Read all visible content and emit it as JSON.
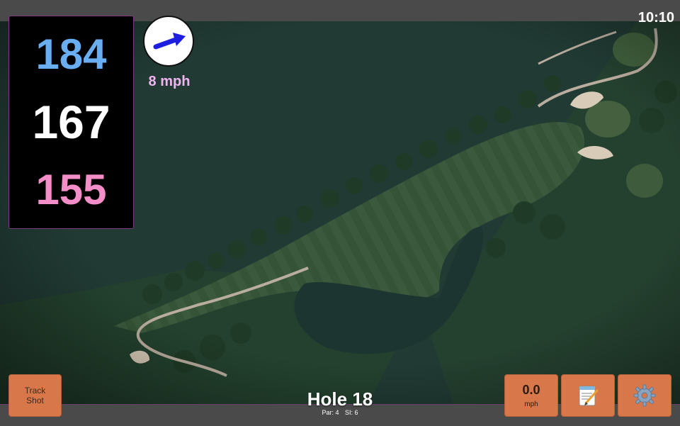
{
  "status": {
    "clock": "10:10"
  },
  "distances": {
    "back": "184",
    "middle": "167",
    "front": "155"
  },
  "wind": {
    "speed_label": "8 mph",
    "arrow_icon": "wind-arrow-icon",
    "arrow_color": "#1e1ee0"
  },
  "buttons": {
    "track_shot_line1": "Track",
    "track_shot_line2": "Shot",
    "speed_value": "0.0",
    "speed_unit": "mph",
    "notes_icon": "notepad-icon",
    "settings_icon": "gear-icon"
  },
  "hole": {
    "title": "Hole 18",
    "par": "Par: 4",
    "si": "SI: 6"
  },
  "colors": {
    "button_bg": "#d8784a",
    "back_dist": "#6aaef2",
    "front_dist": "#f48ec8",
    "wind_text": "#f0b4f0"
  }
}
